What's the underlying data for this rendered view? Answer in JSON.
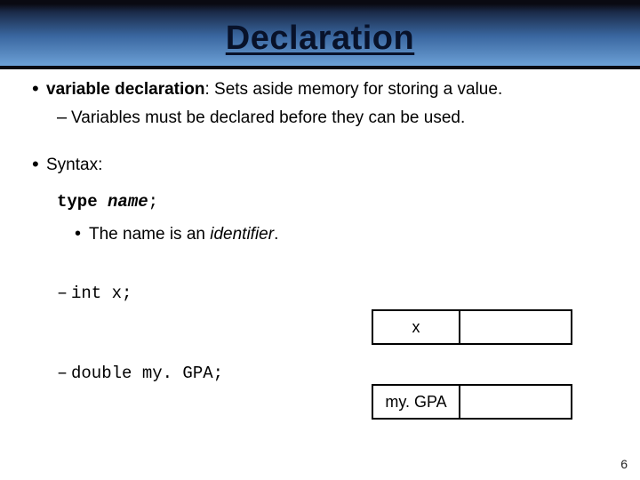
{
  "title": "Declaration",
  "bullets": {
    "b1_term": "variable declaration",
    "b1_rest": ": Sets aside memory for storing a value.",
    "b1_sub": "Variables must be declared before they can be used.",
    "b2": "Syntax:",
    "syntax_type": "type",
    "syntax_name": "name",
    "syntax_semi": ";",
    "b2_sub_prefix": "The name is an ",
    "b2_sub_italic": "identifier",
    "b2_sub_suffix": ".",
    "ex1": "int x;",
    "ex2": "double my. GPA;"
  },
  "boxes": {
    "box1_label": "x",
    "box2_label": "my. GPA"
  },
  "page_number": "6"
}
